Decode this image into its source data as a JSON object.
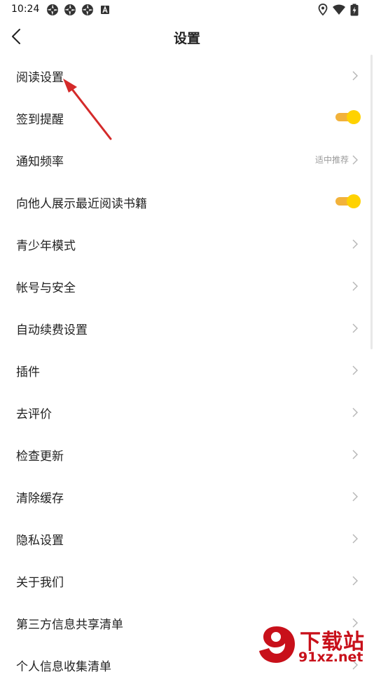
{
  "status_bar": {
    "time": "10:24",
    "app_icons": [
      "aperture-icon",
      "aperture-icon",
      "aperture-icon",
      "font-a-icon"
    ],
    "system_icons": [
      "location-icon",
      "wifi-icon",
      "battery-charging-icon"
    ]
  },
  "header": {
    "back_icon": "back-chevron-icon",
    "title": "设置"
  },
  "settings": {
    "items": [
      {
        "label": "阅读设置",
        "control": "chevron"
      },
      {
        "label": "签到提醒",
        "control": "toggle",
        "on": true
      },
      {
        "label": "通知频率",
        "control": "chevron",
        "value": "适中推荐"
      },
      {
        "label": "向他人展示最近阅读书籍",
        "control": "toggle",
        "on": true
      },
      {
        "label": "青少年模式",
        "control": "chevron"
      },
      {
        "label": "帐号与安全",
        "control": "chevron"
      },
      {
        "label": "自动续费设置",
        "control": "chevron"
      },
      {
        "label": "插件",
        "control": "chevron"
      },
      {
        "label": "去评价",
        "control": "chevron"
      },
      {
        "label": "检查更新",
        "control": "chevron"
      },
      {
        "label": "清除缓存",
        "control": "chevron"
      },
      {
        "label": "隐私设置",
        "control": "chevron"
      },
      {
        "label": "关于我们",
        "control": "chevron"
      },
      {
        "label": "第三方信息共享清单",
        "control": "chevron"
      },
      {
        "label": "个人信息收集清单",
        "control": "chevron"
      }
    ]
  },
  "colors": {
    "toggle_knob": "#ffd200",
    "toggle_track": "#f2b23b",
    "annotation_arrow": "#d42a2a",
    "watermark": "#c8101a"
  },
  "watermark": {
    "logo_glyph": "9",
    "top_text": "下载站",
    "bottom_text": "91xz.net"
  }
}
